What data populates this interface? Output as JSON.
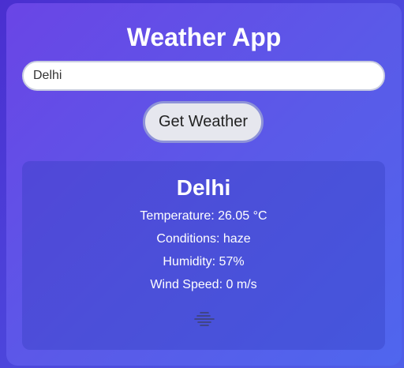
{
  "app": {
    "title": "Weather App"
  },
  "search": {
    "value": "Delhi"
  },
  "actions": {
    "get_weather_label": "Get Weather"
  },
  "result": {
    "city": "Delhi",
    "temperature_label": "Temperature:",
    "temperature_value": "26.05 °C",
    "conditions_label": "Conditions:",
    "conditions_value": "haze",
    "humidity_label": "Humidity:",
    "humidity_value": "57%",
    "wind_label": "Wind Speed:",
    "wind_value": "0 m/s",
    "icon": "haze-icon"
  },
  "colors": {
    "background": "#4a2fd0",
    "card": "#5a5ae8",
    "button_bg": "#e6e7ee",
    "button_border": "#8e93d8",
    "text": "#ffffff"
  }
}
